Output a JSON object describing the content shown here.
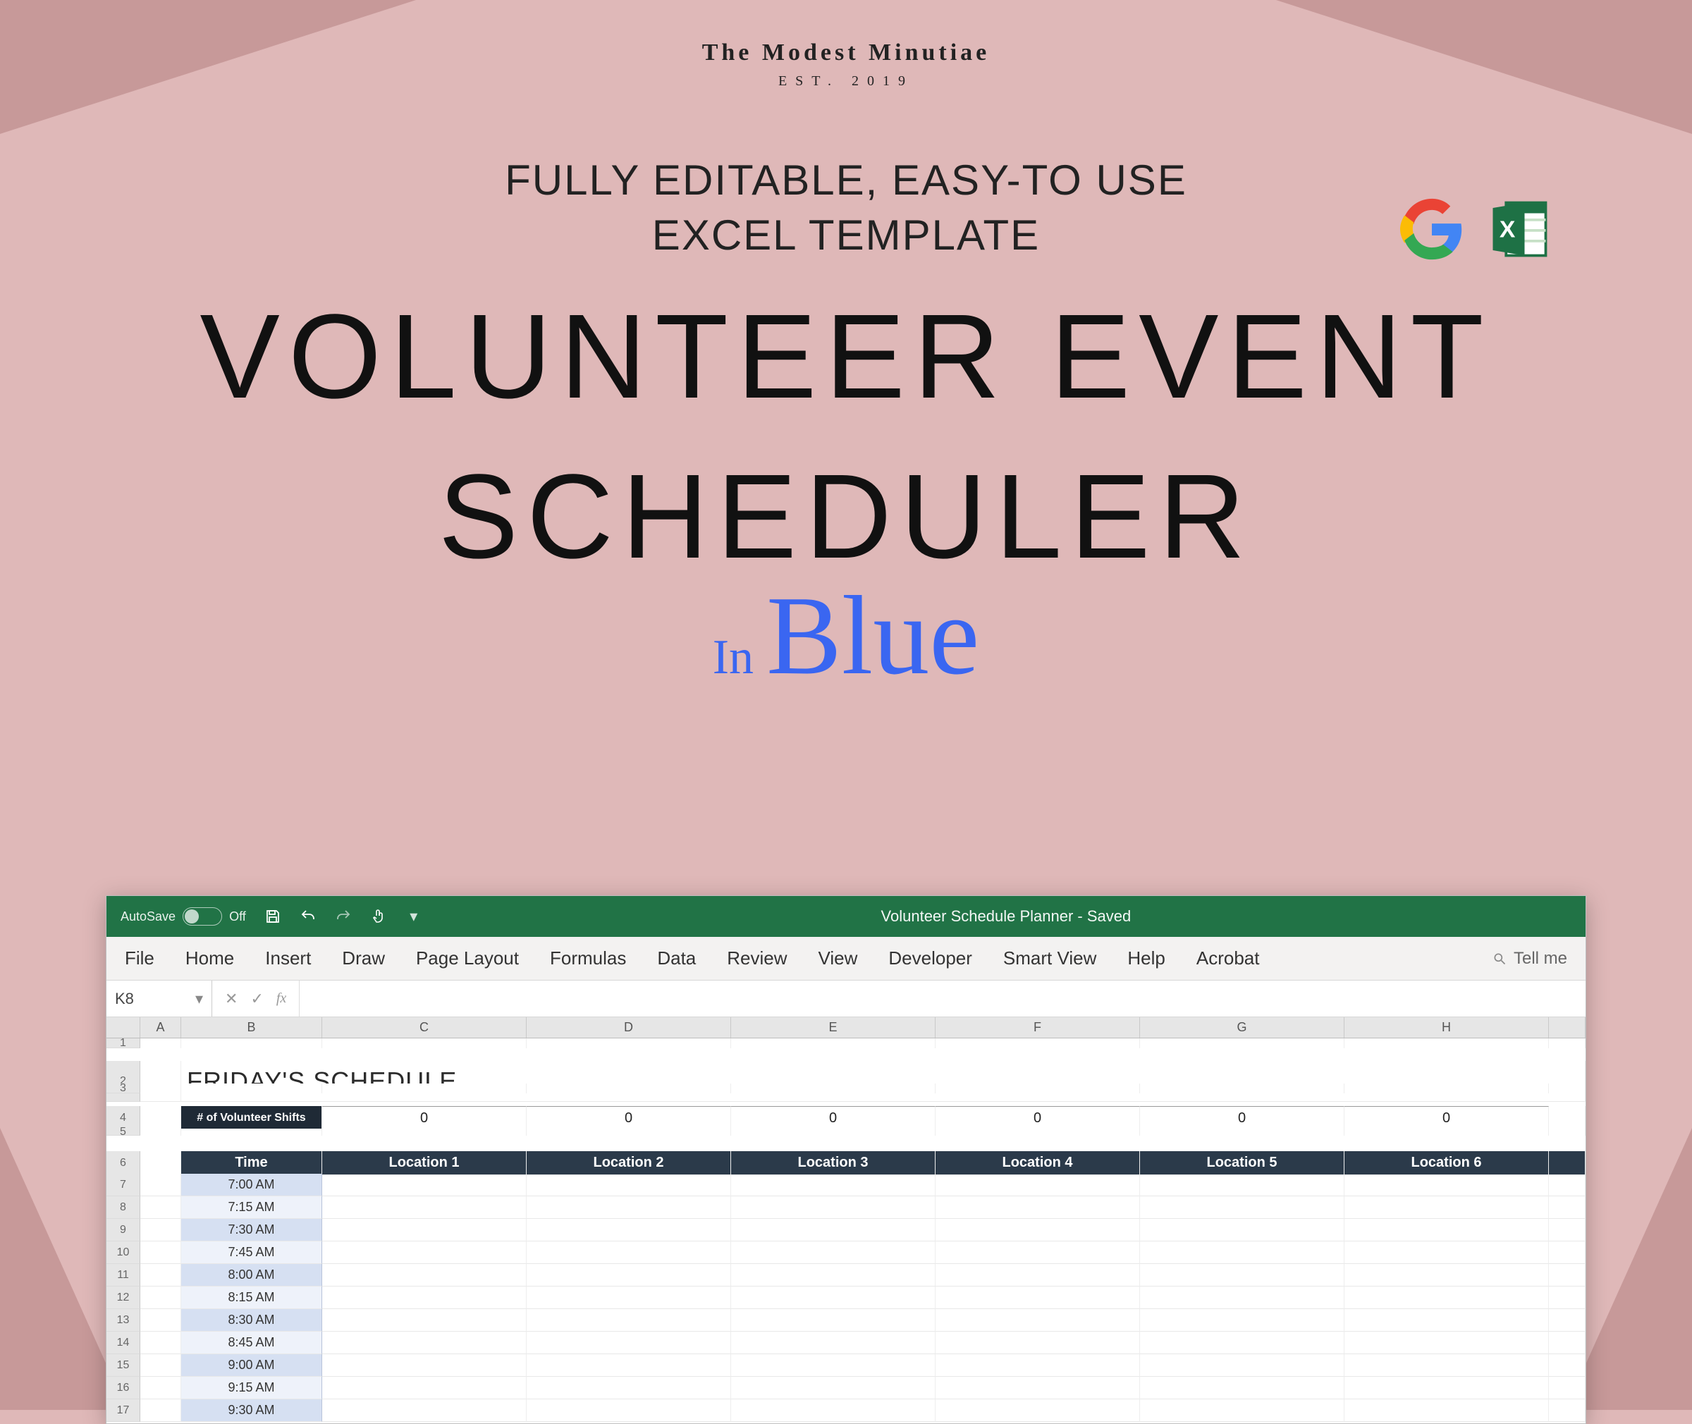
{
  "brand": {
    "name": "The Modest Minutiae",
    "est": "EST. 2019"
  },
  "promo": {
    "subhead_line1": "FULLY EDITABLE, EASY-TO USE",
    "subhead_line2": "EXCEL TEMPLATE",
    "title_line1": "VOLUNTEER EVENT",
    "title_line2": "SCHEDULER",
    "in_text": "In",
    "blue_text": "Blue"
  },
  "icons": {
    "google": "Google",
    "excel": "Excel"
  },
  "excel": {
    "autosave_label": "AutoSave",
    "autosave_state": "Off",
    "doc_title": "Volunteer Schedule Planner  -  Saved",
    "tabs": [
      "File",
      "Home",
      "Insert",
      "Draw",
      "Page Layout",
      "Formulas",
      "Data",
      "Review",
      "View",
      "Developer",
      "Smart View",
      "Help",
      "Acrobat"
    ],
    "tell_me": "Tell me",
    "namebox_value": "K8",
    "fx_label": "fx",
    "col_letters": [
      "",
      "A",
      "B",
      "C",
      "D",
      "E",
      "F",
      "G",
      "H",
      ""
    ],
    "sheet_title": "FRIDAY'S SCHEDULE",
    "shift_label": "# of Volunteer Shifts",
    "shift_counts": [
      "0",
      "0",
      "0",
      "0",
      "0",
      "0"
    ],
    "location_header": "Time",
    "locations": [
      "Location 1",
      "Location 2",
      "Location 3",
      "Location 4",
      "Location 5",
      "Location 6"
    ],
    "row_numbers": [
      "1",
      "2",
      "3",
      "4",
      "5",
      "6",
      "7",
      "8",
      "9",
      "10",
      "11",
      "12",
      "13",
      "14",
      "15",
      "16",
      "17"
    ],
    "times": [
      "7:00 AM",
      "7:15 AM",
      "7:30 AM",
      "7:45 AM",
      "8:00 AM",
      "8:15 AM",
      "8:30 AM",
      "8:45 AM",
      "9:00 AM",
      "9:15 AM",
      "9:30 AM"
    ]
  }
}
